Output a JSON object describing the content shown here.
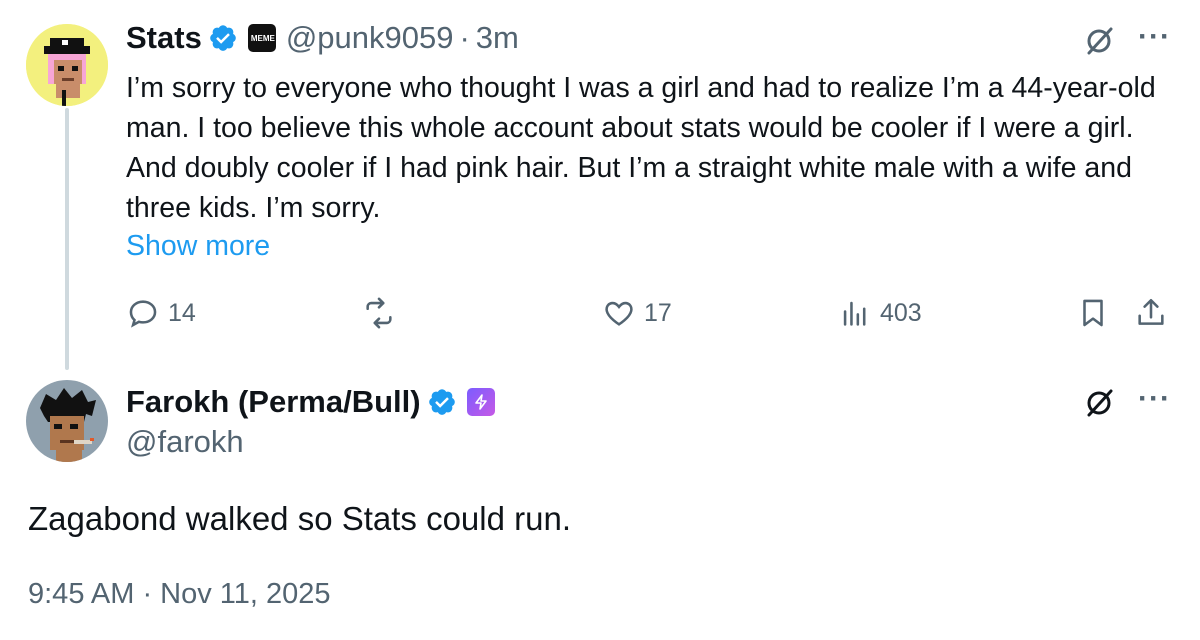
{
  "tweet": {
    "author_name": "Stats",
    "handle": "@punk9059",
    "separator": "·",
    "time_ago": "3m",
    "affiliate_badge_text": "MEME LAND",
    "text": "I’m sorry to everyone who thought I was a girl and had to realize I’m a 44-year-old man. I too believe this whole account about stats would be cooler if I were a girl. And doubly cooler if I had pink hair. But I’m a straight white male with a wife and three kids. I’m sorry.",
    "show_more": "Show more",
    "more_label": "···",
    "actions": {
      "replies": "14",
      "likes": "17",
      "views": "403"
    }
  },
  "main_post": {
    "author_name": "Farokh (Perma/Bull)",
    "handle": "@farokh",
    "more_label": "···",
    "text": "Zagabond walked so Stats could run.",
    "timestamp": "9:45 AM · Nov 11, 2025"
  },
  "colors": {
    "link": "#1d9bf0",
    "verified": "#1d9bf0",
    "muted": "#536471",
    "thread_line": "#cfd9de"
  }
}
